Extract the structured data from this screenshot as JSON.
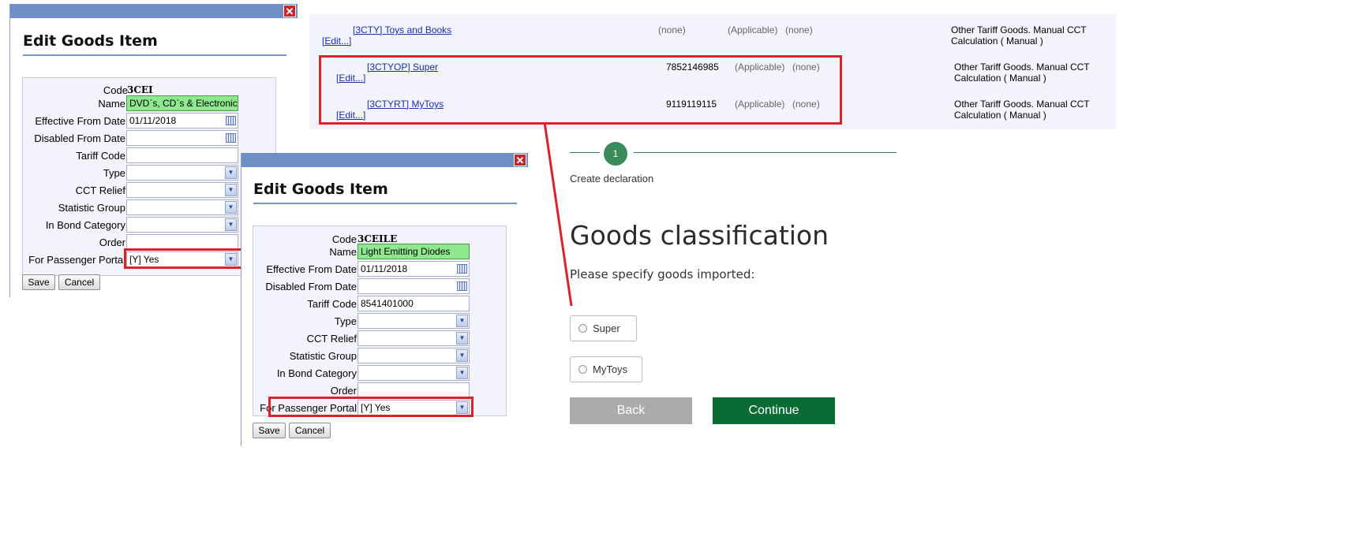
{
  "dialog1": {
    "title": "Edit Goods Item",
    "close": "✕",
    "fields": {
      "code_label": "Code",
      "code_value": "3CEI",
      "name_label": "Name",
      "name_value": "DVD`s, CD`s & Electronic",
      "eff_label": "Effective From Date",
      "eff_value": "01/11/2018",
      "dis_label": "Disabled From Date",
      "dis_value": "",
      "tariff_label": "Tariff Code",
      "tariff_value": "",
      "type_label": "Type",
      "type_value": "",
      "cct_label": "CCT Relief",
      "cct_value": "",
      "stat_label": "Statistic Group",
      "stat_value": "",
      "bond_label": "In Bond Category",
      "bond_value": "",
      "order_label": "Order",
      "order_value": "",
      "portal_label": "For Passenger Portal",
      "portal_value": "[Y] Yes"
    },
    "save": "Save",
    "cancel": "Cancel"
  },
  "dialog2": {
    "title": "Edit Goods Item",
    "close": "✕",
    "fields": {
      "code_label": "Code",
      "code_value": "3CEILE",
      "name_label": "Name",
      "name_value": "Light Emitting Diodes",
      "eff_label": "Effective From Date",
      "eff_value": "01/11/2018",
      "dis_label": "Disabled From Date",
      "dis_value": "",
      "tariff_label": "Tariff Code",
      "tariff_value": "8541401000",
      "type_label": "Type",
      "type_value": "",
      "cct_label": "CCT Relief",
      "cct_value": "",
      "stat_label": "Statistic Group",
      "stat_value": "",
      "bond_label": "In Bond Category",
      "bond_value": "",
      "order_label": "Order",
      "order_value": "",
      "portal_label": "For Passenger Portal",
      "portal_value": "[Y] Yes"
    },
    "save": "Save",
    "cancel": "Cancel"
  },
  "goods_table": {
    "rows": [
      {
        "name": "[3CTY] Toys and Books",
        "edit": "[Edit...]",
        "tariff": "(none)",
        "applicable": "(Applicable)",
        "extra": "(none)",
        "category_line1": "Other Tariff Goods. Manual CCT",
        "category_line2": "Calculation ( Manual )"
      },
      {
        "name": "[3CTYOP] Super",
        "edit": "[Edit...]",
        "tariff": "7852146985",
        "applicable": "(Applicable)",
        "extra": "(none)",
        "category_line1": "Other Tariff Goods. Manual CCT",
        "category_line2": "Calculation ( Manual )"
      },
      {
        "name": "[3CTYRT] MyToys",
        "edit": "[Edit...]",
        "tariff": "9119119115",
        "applicable": "(Applicable)",
        "extra": "(none)",
        "category_line1": "Other Tariff Goods. Manual CCT",
        "category_line2": "Calculation ( Manual )"
      }
    ]
  },
  "wizard": {
    "step_number": "1",
    "step_label": "Create declaration",
    "heading": "Goods classification",
    "prompt": "Please specify goods imported:",
    "options": [
      "Super",
      "MyToys"
    ],
    "back": "Back",
    "continue": "Continue"
  },
  "colors": {
    "highlight_red": "#d8232a",
    "titlebar_blue": "#6d8fc6",
    "continue_green": "#0b6b34",
    "back_grey": "#ababab",
    "name_field_green": "#8ee88e"
  }
}
